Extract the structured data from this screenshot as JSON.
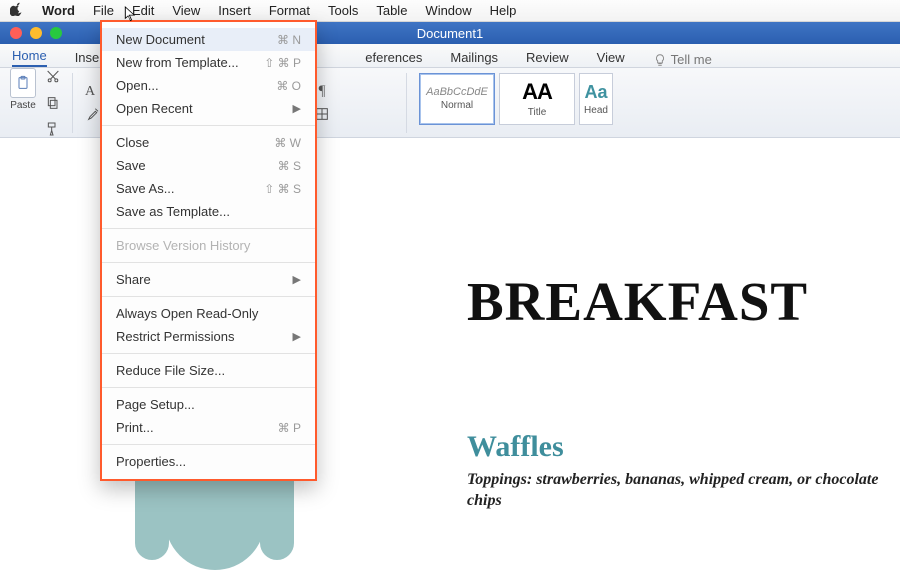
{
  "menubar": {
    "app": "Word",
    "items": [
      "File",
      "Edit",
      "View",
      "Insert",
      "Format",
      "Tools",
      "Table",
      "Window",
      "Help"
    ]
  },
  "window": {
    "title": "Document1"
  },
  "tabs": {
    "home": "Home",
    "insert_partial": "Inse",
    "references_partial": "eferences",
    "mailings": "Mailings",
    "review": "Review",
    "view": "View",
    "tellme": "Tell me"
  },
  "ribbon": {
    "paste": "Paste",
    "styles": {
      "normal_sample": "AaBbCcDdE",
      "normal": "Normal",
      "title_sample": "AA",
      "title": "Title",
      "head_sample": "Aa",
      "head": "Head"
    }
  },
  "fileMenu": {
    "new_doc": "New Document",
    "new_doc_sc": "⌘ N",
    "new_tpl": "New from Template...",
    "new_tpl_sc": "⇧ ⌘ P",
    "open": "Open...",
    "open_sc": "⌘ O",
    "open_recent": "Open Recent",
    "close": "Close",
    "close_sc": "⌘ W",
    "save": "Save",
    "save_sc": "⌘ S",
    "save_as": "Save As...",
    "save_as_sc": "⇧ ⌘ S",
    "save_tpl": "Save as Template...",
    "browse": "Browse Version History",
    "share": "Share",
    "readonly": "Always Open Read-Only",
    "restrict": "Restrict Permissions",
    "reduce": "Reduce File Size...",
    "page_setup": "Page Setup...",
    "print": "Print...",
    "print_sc": "⌘ P",
    "properties": "Properties..."
  },
  "document": {
    "heading1": "BREAKFAST",
    "heading2": "Waffles",
    "body1": "Toppings: strawberries, bananas, whipped cream, or chocolate chips"
  }
}
